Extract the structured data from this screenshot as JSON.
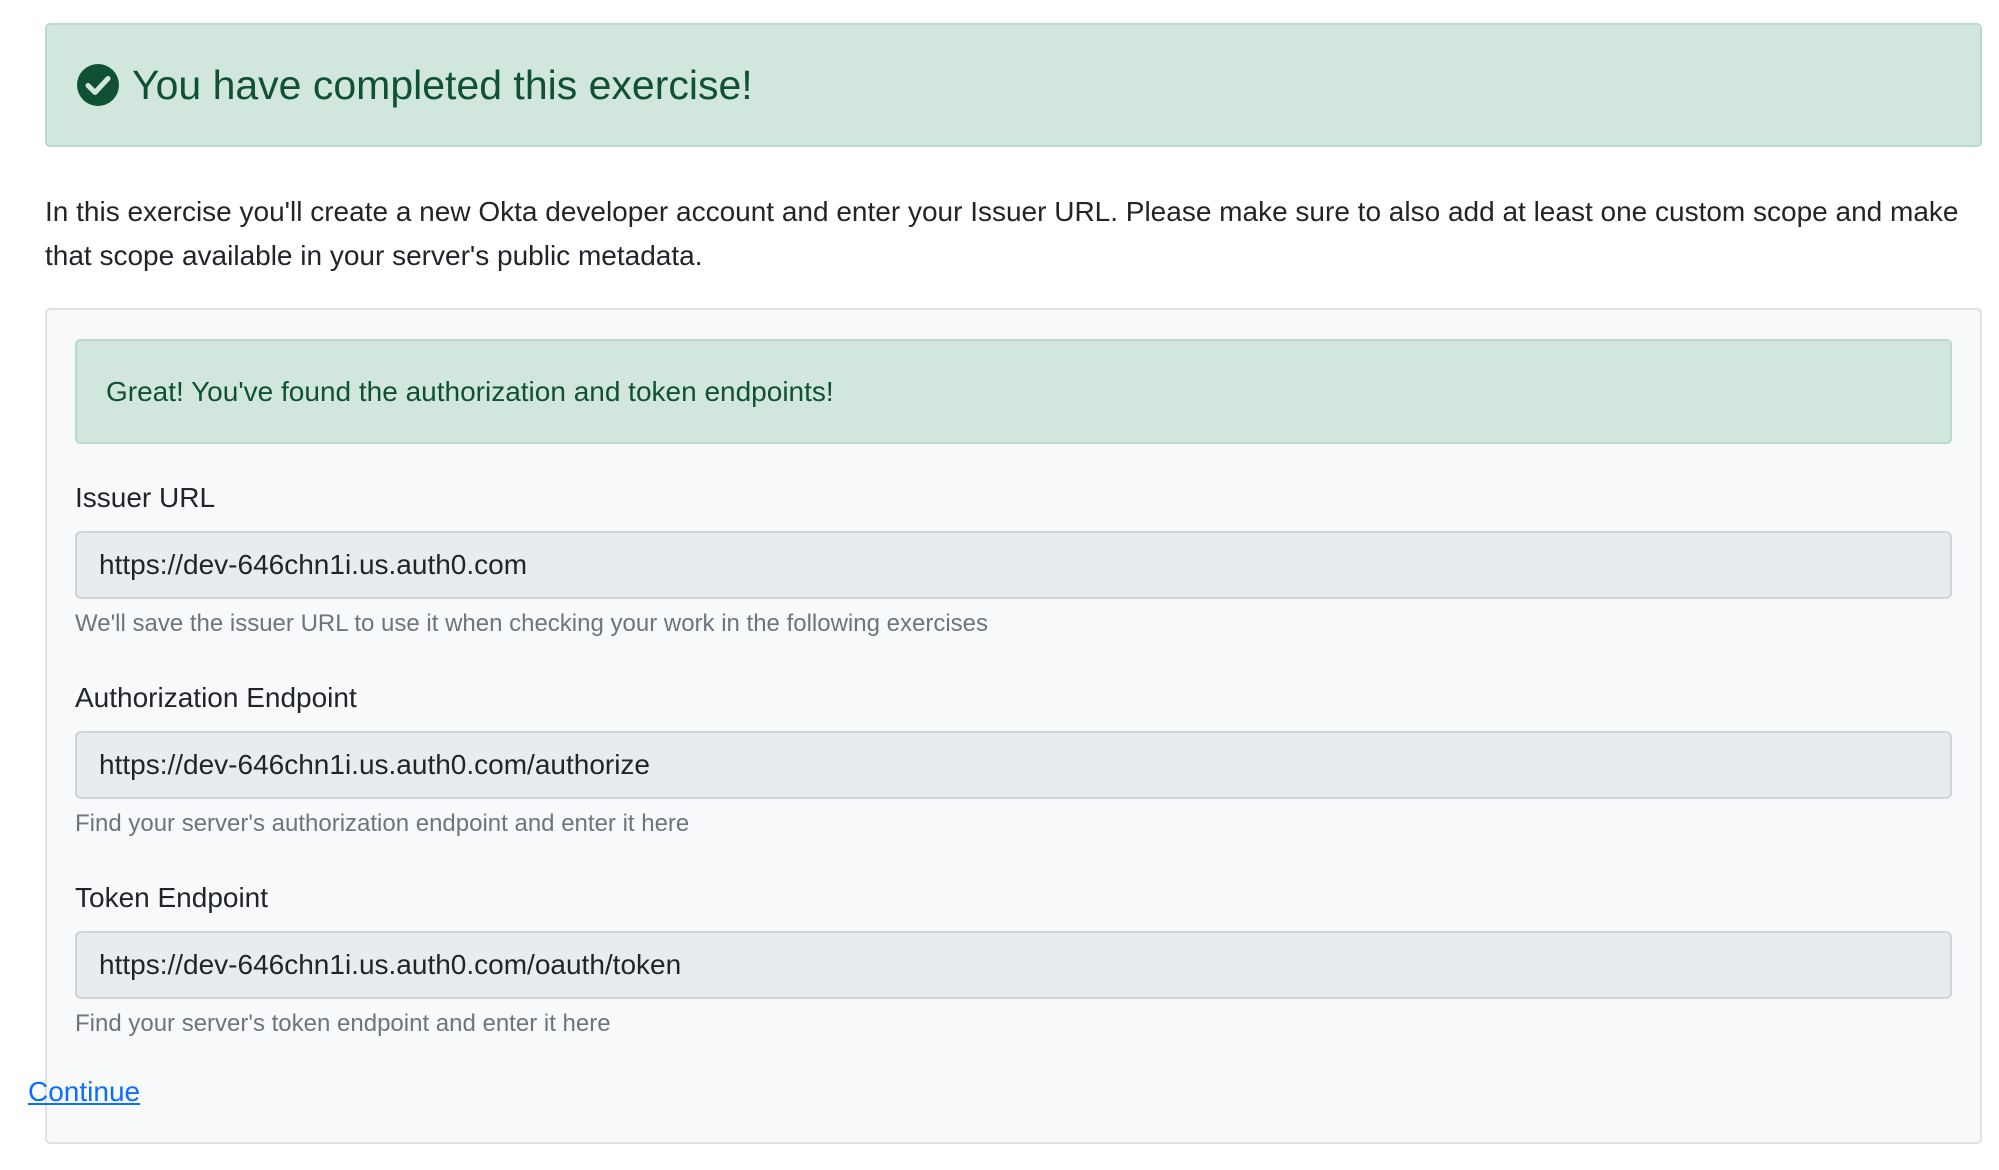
{
  "banner": {
    "icon": "check-circle-icon",
    "text": "You have completed this exercise!"
  },
  "intro": {
    "text": "In this exercise you'll create a new Okta developer account and enter your Issuer URL. Please make sure to also add at least one custom scope and make that scope available in your server's public metadata."
  },
  "alert": {
    "text": "Great! You've found the authorization and token endpoints!"
  },
  "fields": {
    "issuer": {
      "label": "Issuer URL",
      "value": "https://dev-646chn1i.us.auth0.com",
      "help": "We'll save the issuer URL to use it when checking your work in the following exercises"
    },
    "authorization": {
      "label": "Authorization Endpoint",
      "value": "https://dev-646chn1i.us.auth0.com/authorize",
      "help": "Find your server's authorization endpoint and enter it here"
    },
    "token": {
      "label": "Token Endpoint",
      "value": "https://dev-646chn1i.us.auth0.com/oauth/token",
      "help": "Find your server's token endpoint and enter it here"
    }
  },
  "continue_link": {
    "label": "Continue"
  },
  "colors": {
    "success_bg": "#d1e7dd",
    "success_text": "#0f5132",
    "link": "#0d6efd",
    "muted": "#6c757d"
  }
}
